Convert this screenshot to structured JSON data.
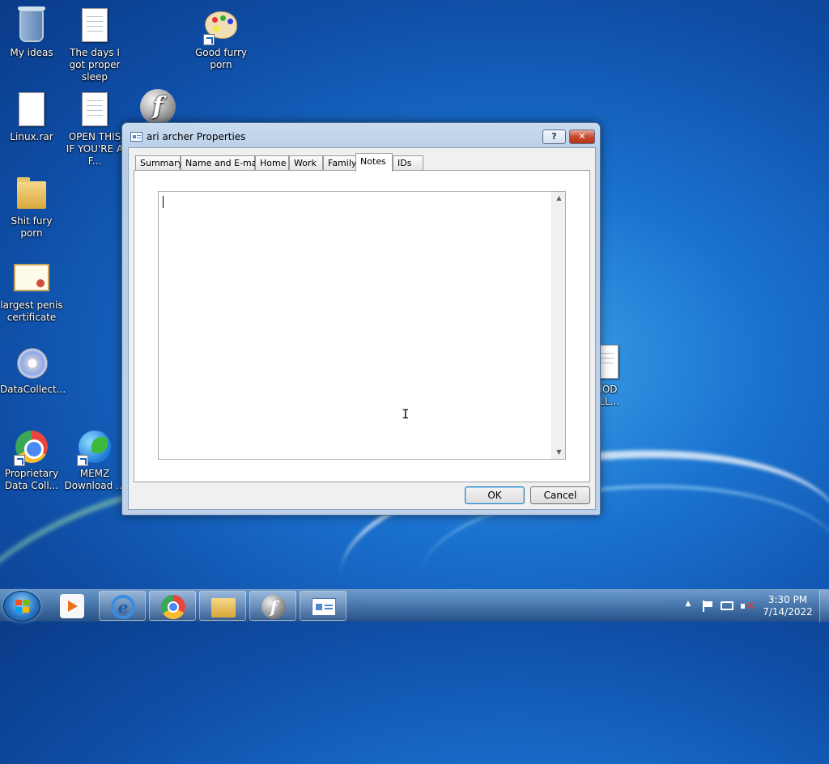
{
  "desktop": {
    "icons": {
      "my_ideas": "My ideas",
      "days_sleep": "The days I got proper sleep",
      "good_furry": "Good furry porn",
      "linux_rar": "Linux.rar",
      "open_this": "OPEN THIS IF YOU'RE A F...",
      "shit_fury": "Shit fury porn",
      "certificate": "largest penis certificate",
      "datacollect": "DataCollect...",
      "proprietary": "Proprietary Data Coll...",
      "memz": "MEMZ Download ...",
      "mod_coll": "MOD OLL..."
    }
  },
  "dialog": {
    "title": "ari archer Properties",
    "help_label": "?",
    "close_label": "✕",
    "tabs": [
      "Summary",
      "Name and E-mail",
      "Home",
      "Work",
      "Family",
      "Notes",
      "IDs"
    ],
    "active_tab": "Notes",
    "notes_value": "",
    "ok_label": "OK",
    "cancel_label": "Cancel"
  },
  "taskbar": {
    "clock_time": "3:30 PM",
    "clock_date": "7/14/2022",
    "tray_expand": "▲"
  },
  "colors": {
    "desktop_blue": "#1a72cf",
    "dialog_chrome": "#bed1e8",
    "close_red": "#c9472f",
    "ok_border": "#3c7fb1"
  }
}
